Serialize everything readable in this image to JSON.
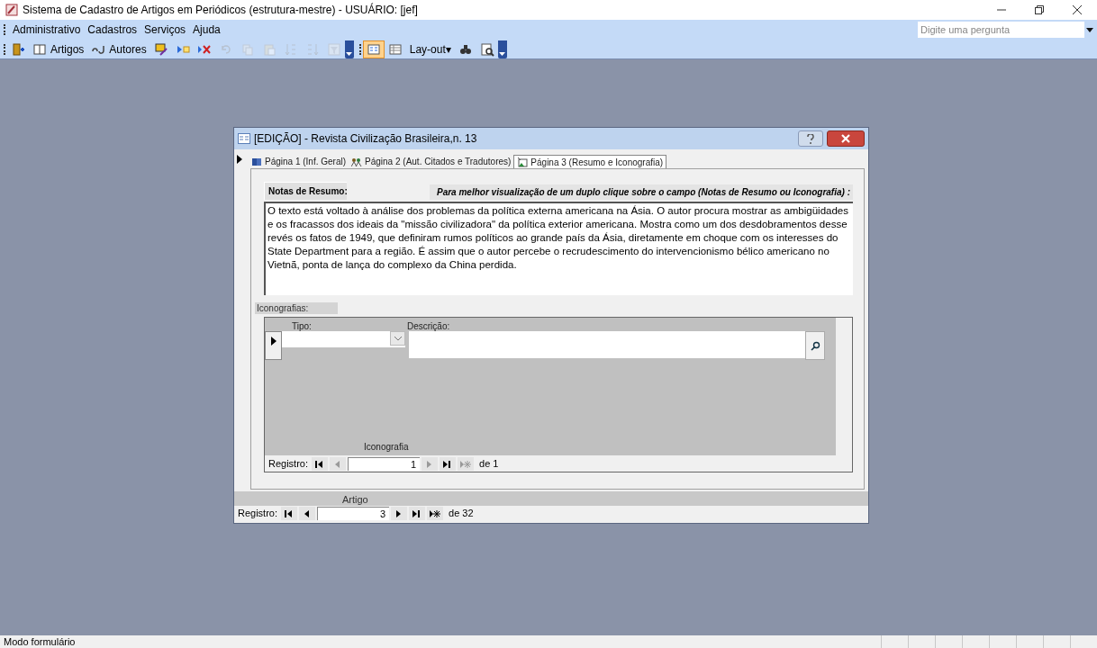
{
  "window": {
    "title": "Sistema de Cadastro de Artigos em Periódicos (estrutura-mestre) - USUÁRIO: [jef]"
  },
  "menu": [
    "Administrativo",
    "Cadastros",
    "Serviços",
    "Ajuda"
  ],
  "help_search": {
    "placeholder": "Digite uma pergunta"
  },
  "toolbar": [
    {
      "kind": "icon",
      "disabled": false,
      "selected": false
    },
    {
      "kind": "text",
      "label": "Artigos",
      "disabled": false,
      "selected": false
    },
    {
      "kind": "text",
      "label": "Autores",
      "disabled": false,
      "selected": false
    },
    {
      "kind": "icon",
      "disabled": false,
      "selected": false
    },
    {
      "kind": "icon",
      "disabled": false,
      "selected": false
    },
    {
      "kind": "icon",
      "disabled": false,
      "selected": false
    },
    {
      "kind": "icon",
      "disabled": true,
      "selected": false
    },
    {
      "kind": "icon",
      "disabled": true,
      "selected": false
    },
    {
      "kind": "icon",
      "disabled": true,
      "selected": false
    },
    {
      "kind": "icon",
      "disabled": true,
      "selected": false
    },
    {
      "kind": "icon",
      "disabled": true,
      "selected": false
    },
    {
      "kind": "icon",
      "disabled": true,
      "selected": false
    },
    {
      "kind": "overflow"
    },
    {
      "kind": "icon",
      "disabled": false,
      "selected": true
    },
    {
      "kind": "icon",
      "disabled": false,
      "selected": false
    },
    {
      "kind": "text",
      "label": "Lay-out▾",
      "disabled": false,
      "selected": false
    },
    {
      "kind": "icon",
      "disabled": false,
      "selected": false
    },
    {
      "kind": "icon",
      "disabled": false,
      "selected": false
    },
    {
      "kind": "overflow"
    }
  ],
  "dialog": {
    "title": "[EDIÇÃO] - Revista Civilização Brasileira,n. 13",
    "tabs": [
      {
        "label": "Página 1 (Inf. Geral)",
        "selected": false
      },
      {
        "label": "Página 2 (Aut. Citados e Tradutores)",
        "selected": false
      },
      {
        "label": "Página 3 (Resumo e Iconografia)",
        "selected": true
      }
    ],
    "notes_label": "Notas de Resumo:",
    "hint": "Para melhor visualização de um duplo clique sobre o campo (Notas de Resumo ou Iconografia) :",
    "notes": "O texto está voltado à análise dos problemas da política externa americana na Ásia. O autor procura mostrar as ambigüidades e os fracassos dos ideais da \"missão civilizadora\" da política exterior americana. Mostra como um dos desdobramentos desse revés os fatos de 1949, que definiram rumos políticos ao grande país da Ásia, diretamente em choque com os interesses do State Department para a região. É assim que o autor percebe o recrudescimento do intervencionismo bélico americano no Vietnã, ponta de lança do complexo da China perdida.",
    "iconography_label": "Iconografias:",
    "subform": {
      "columns": [
        "Tipo:",
        "Descrição:"
      ],
      "caption": "Iconografia",
      "navigation": {
        "label": "Registro:",
        "current": "1",
        "total": "de 1",
        "buttons": [
          {
            "kind": "first",
            "disabled": false
          },
          {
            "kind": "prev",
            "disabled": true
          },
          {
            "kind": "next",
            "disabled": true
          },
          {
            "kind": "last",
            "disabled": false
          },
          {
            "kind": "new",
            "disabled": true
          }
        ]
      }
    },
    "caption": "Artigo",
    "navigation": {
      "label": "Registro:",
      "current": "3",
      "total": "de 32",
      "buttons": [
        {
          "kind": "first",
          "disabled": false
        },
        {
          "kind": "prev",
          "disabled": false
        },
        {
          "kind": "next",
          "disabled": false
        },
        {
          "kind": "last",
          "disabled": false
        },
        {
          "kind": "new",
          "disabled": false
        }
      ]
    }
  },
  "status_bar": {
    "text": "Modo formulário"
  }
}
